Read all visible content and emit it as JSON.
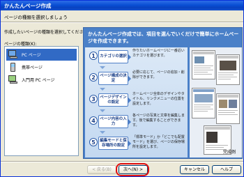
{
  "window": {
    "title": "かんたんページ作成"
  },
  "header": {
    "instruction": "ページの種類を選択しましょう"
  },
  "left": {
    "label": "作成したいページの種類を選択してください。",
    "list_label": "ページの種類(K):",
    "items": [
      {
        "label": "PC ページ",
        "icon": "pc-page-icon",
        "selected": true
      },
      {
        "label": "携帯ページ",
        "icon": "mobile-page-icon",
        "selected": false
      },
      {
        "label": "入門用 PC ページ",
        "icon": "beginner-pc-page-icon",
        "selected": false
      }
    ]
  },
  "right": {
    "title": "かんたんページ作成では、項目を選んでいくだけで簡単にホームページを作成できます。",
    "steps": [
      {
        "num": "1",
        "name": "カテゴリの選択",
        "desc": "作りたいホームページに一番近いカテゴリを選びます。"
      },
      {
        "num": "2",
        "name": "ページ構成の決定",
        "desc": "必要に応じて、ページの追加・削除ができます。"
      },
      {
        "num": "3",
        "name": "ページデザインの設定",
        "desc": "ホームページ全体のデザインやタイトル、リンクメニューの位置を設定します。"
      },
      {
        "num": "4",
        "name": "ページ内容の入力",
        "desc": "各ページの写真と文章を編集します。後で編集することができます。"
      },
      {
        "num": "5",
        "name": "編集モードと保存場所の設定",
        "desc": "「標準モード」か「どこでも配置モード」を選び、ページの保存場所を設定します。"
      }
    ],
    "done_label": "完成例"
  },
  "buttons": {
    "back": "< 戻る(B)",
    "next": "次へ(N) >",
    "cancel": "キャンセル",
    "help": "ヘルプ"
  },
  "colors": {
    "accent": "#316ac5",
    "panel": "#4a80c8",
    "highlight": "#e01010"
  }
}
